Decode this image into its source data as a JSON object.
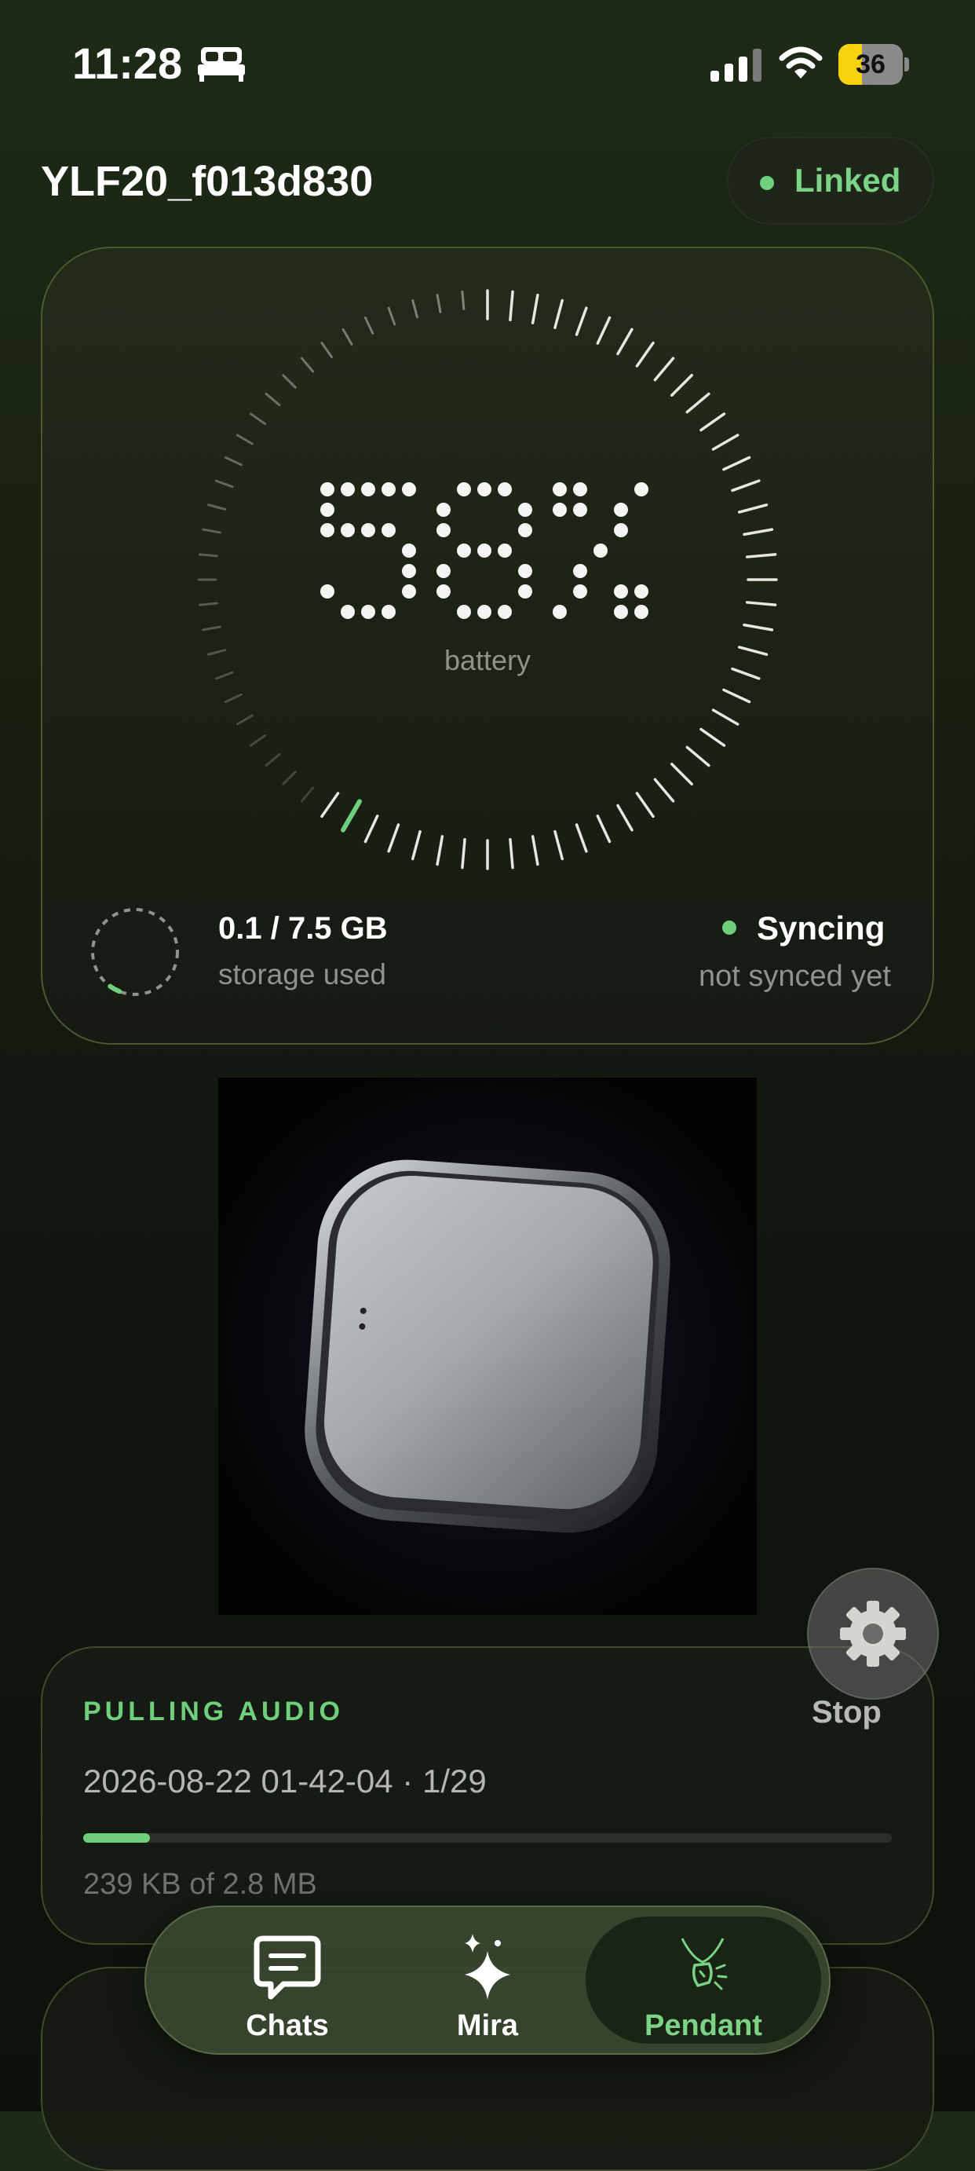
{
  "status_bar": {
    "time": "11:28",
    "battery_percent": "36",
    "battery_level": 0.36,
    "icons": [
      "bed-icon",
      "cellular-signal-icon",
      "wifi-icon",
      "battery-icon"
    ]
  },
  "header": {
    "device_name": "YLF20_f013d830",
    "link_status": "Linked"
  },
  "battery_panel": {
    "value": "58%",
    "caption": "battery",
    "level": 0.58
  },
  "storage": {
    "value": "0.1 / 7.5 GB",
    "caption": "storage used",
    "used_fraction": 0.013
  },
  "sync": {
    "status": "Syncing",
    "caption": "not synced yet"
  },
  "audio": {
    "title": "PULLING AUDIO",
    "stop_label": "Stop",
    "file": "2026-08-22 01-42-04  ·  1/29",
    "progress": 0.083,
    "size": "239 KB of 2.8 MB"
  },
  "tabs": [
    {
      "label": "Chats",
      "icon": "chat-bubble-icon"
    },
    {
      "label": "Mira",
      "icon": "sparkles-icon"
    },
    {
      "label": "Pendant",
      "icon": "pendant-icon",
      "active": true
    }
  ],
  "colors": {
    "accent": "#6fcf7a",
    "background": "#161d12",
    "card_border": "#4a5a2e"
  }
}
